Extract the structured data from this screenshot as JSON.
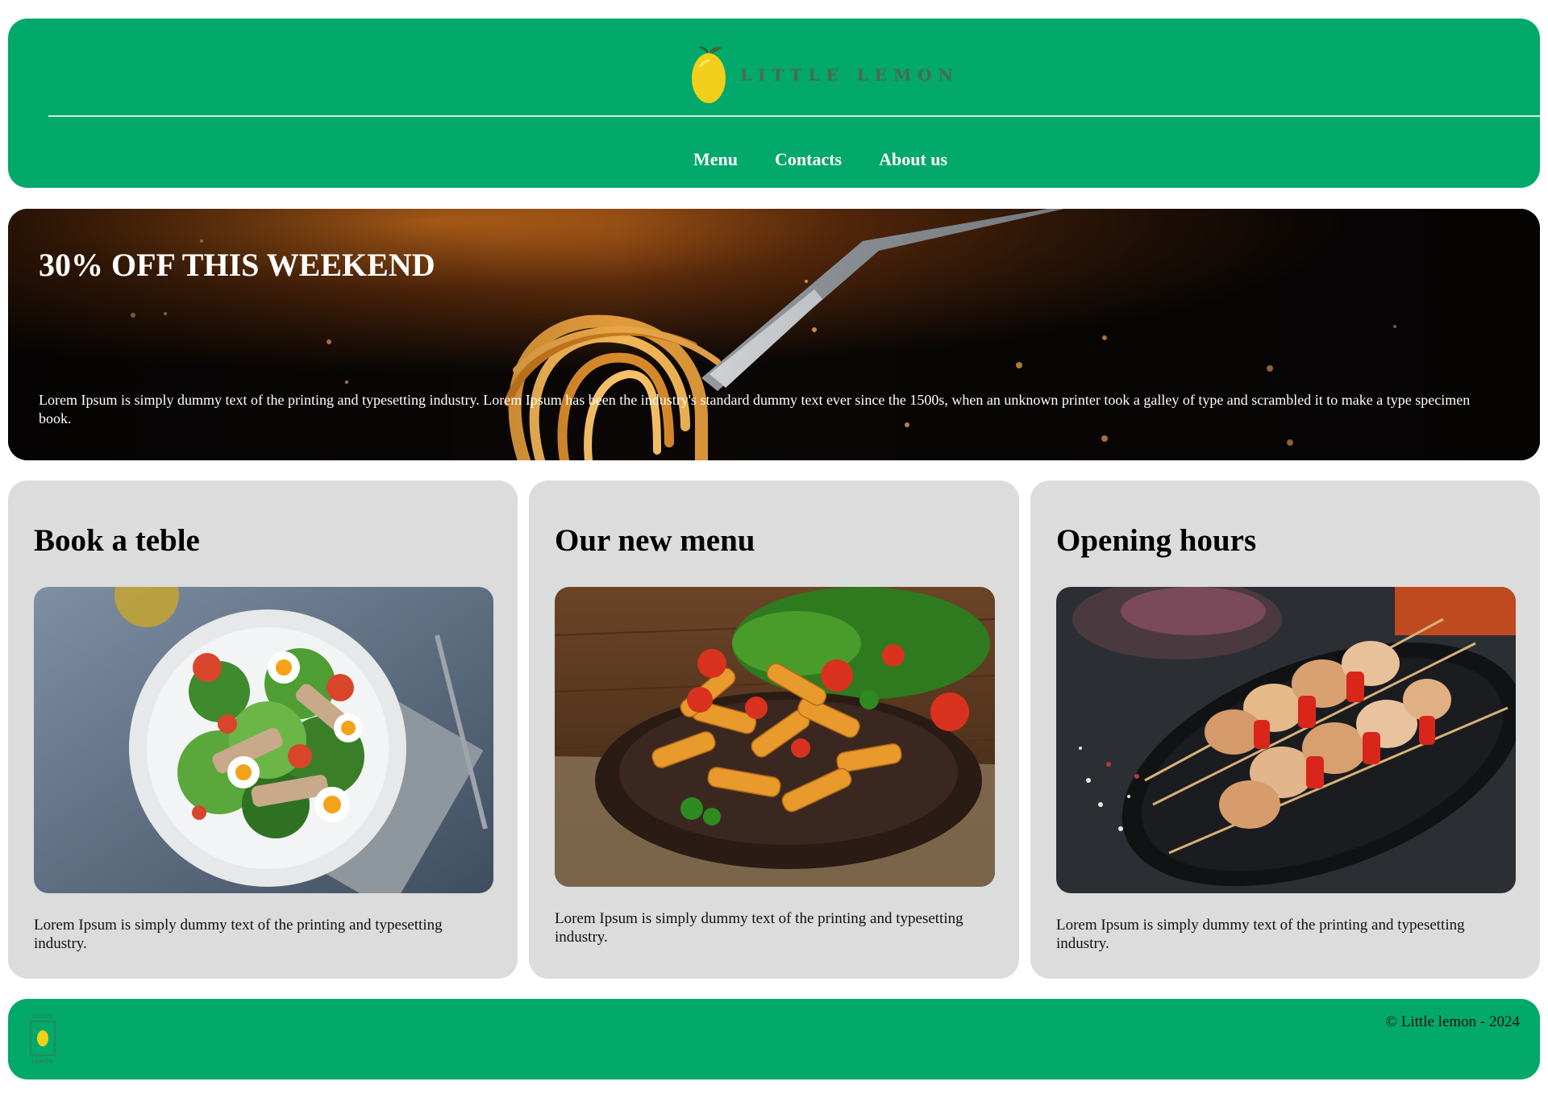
{
  "brand": {
    "name": "LITTLE LEMON"
  },
  "nav": {
    "items": [
      "Menu",
      "Contacts",
      "About us"
    ]
  },
  "hero": {
    "title": "30% OFF THIS WEEKEND",
    "text": "Lorem Ipsum is simply dummy text of the printing and typesetting industry. Lorem Ipsum has been the industry's standard dummy text ever since the 1500s, when an unknown printer took a galley of type and scrambled it to make a type specimen book."
  },
  "cards": [
    {
      "title": "Book a teble",
      "text": "Lorem Ipsum is simply dummy text of the printing and typesetting industry.",
      "image": "salad-photo"
    },
    {
      "title": "Our new menu",
      "text": "Lorem Ipsum is simply dummy text of the printing and typesetting industry.",
      "image": "pasta-photo"
    },
    {
      "title": "Opening hours",
      "text": "Lorem Ipsum is simply dummy text of the printing and typesetting industry.",
      "image": "skewers-photo"
    }
  ],
  "footer": {
    "copyright": "© Little lemon - 2024",
    "logo_top": "LITTLE",
    "logo_bottom": "LEMON"
  },
  "colors": {
    "brand_green": "#03a86b",
    "card_gray": "#dcdcdc",
    "lemon_yellow": "#f2cf1a"
  }
}
